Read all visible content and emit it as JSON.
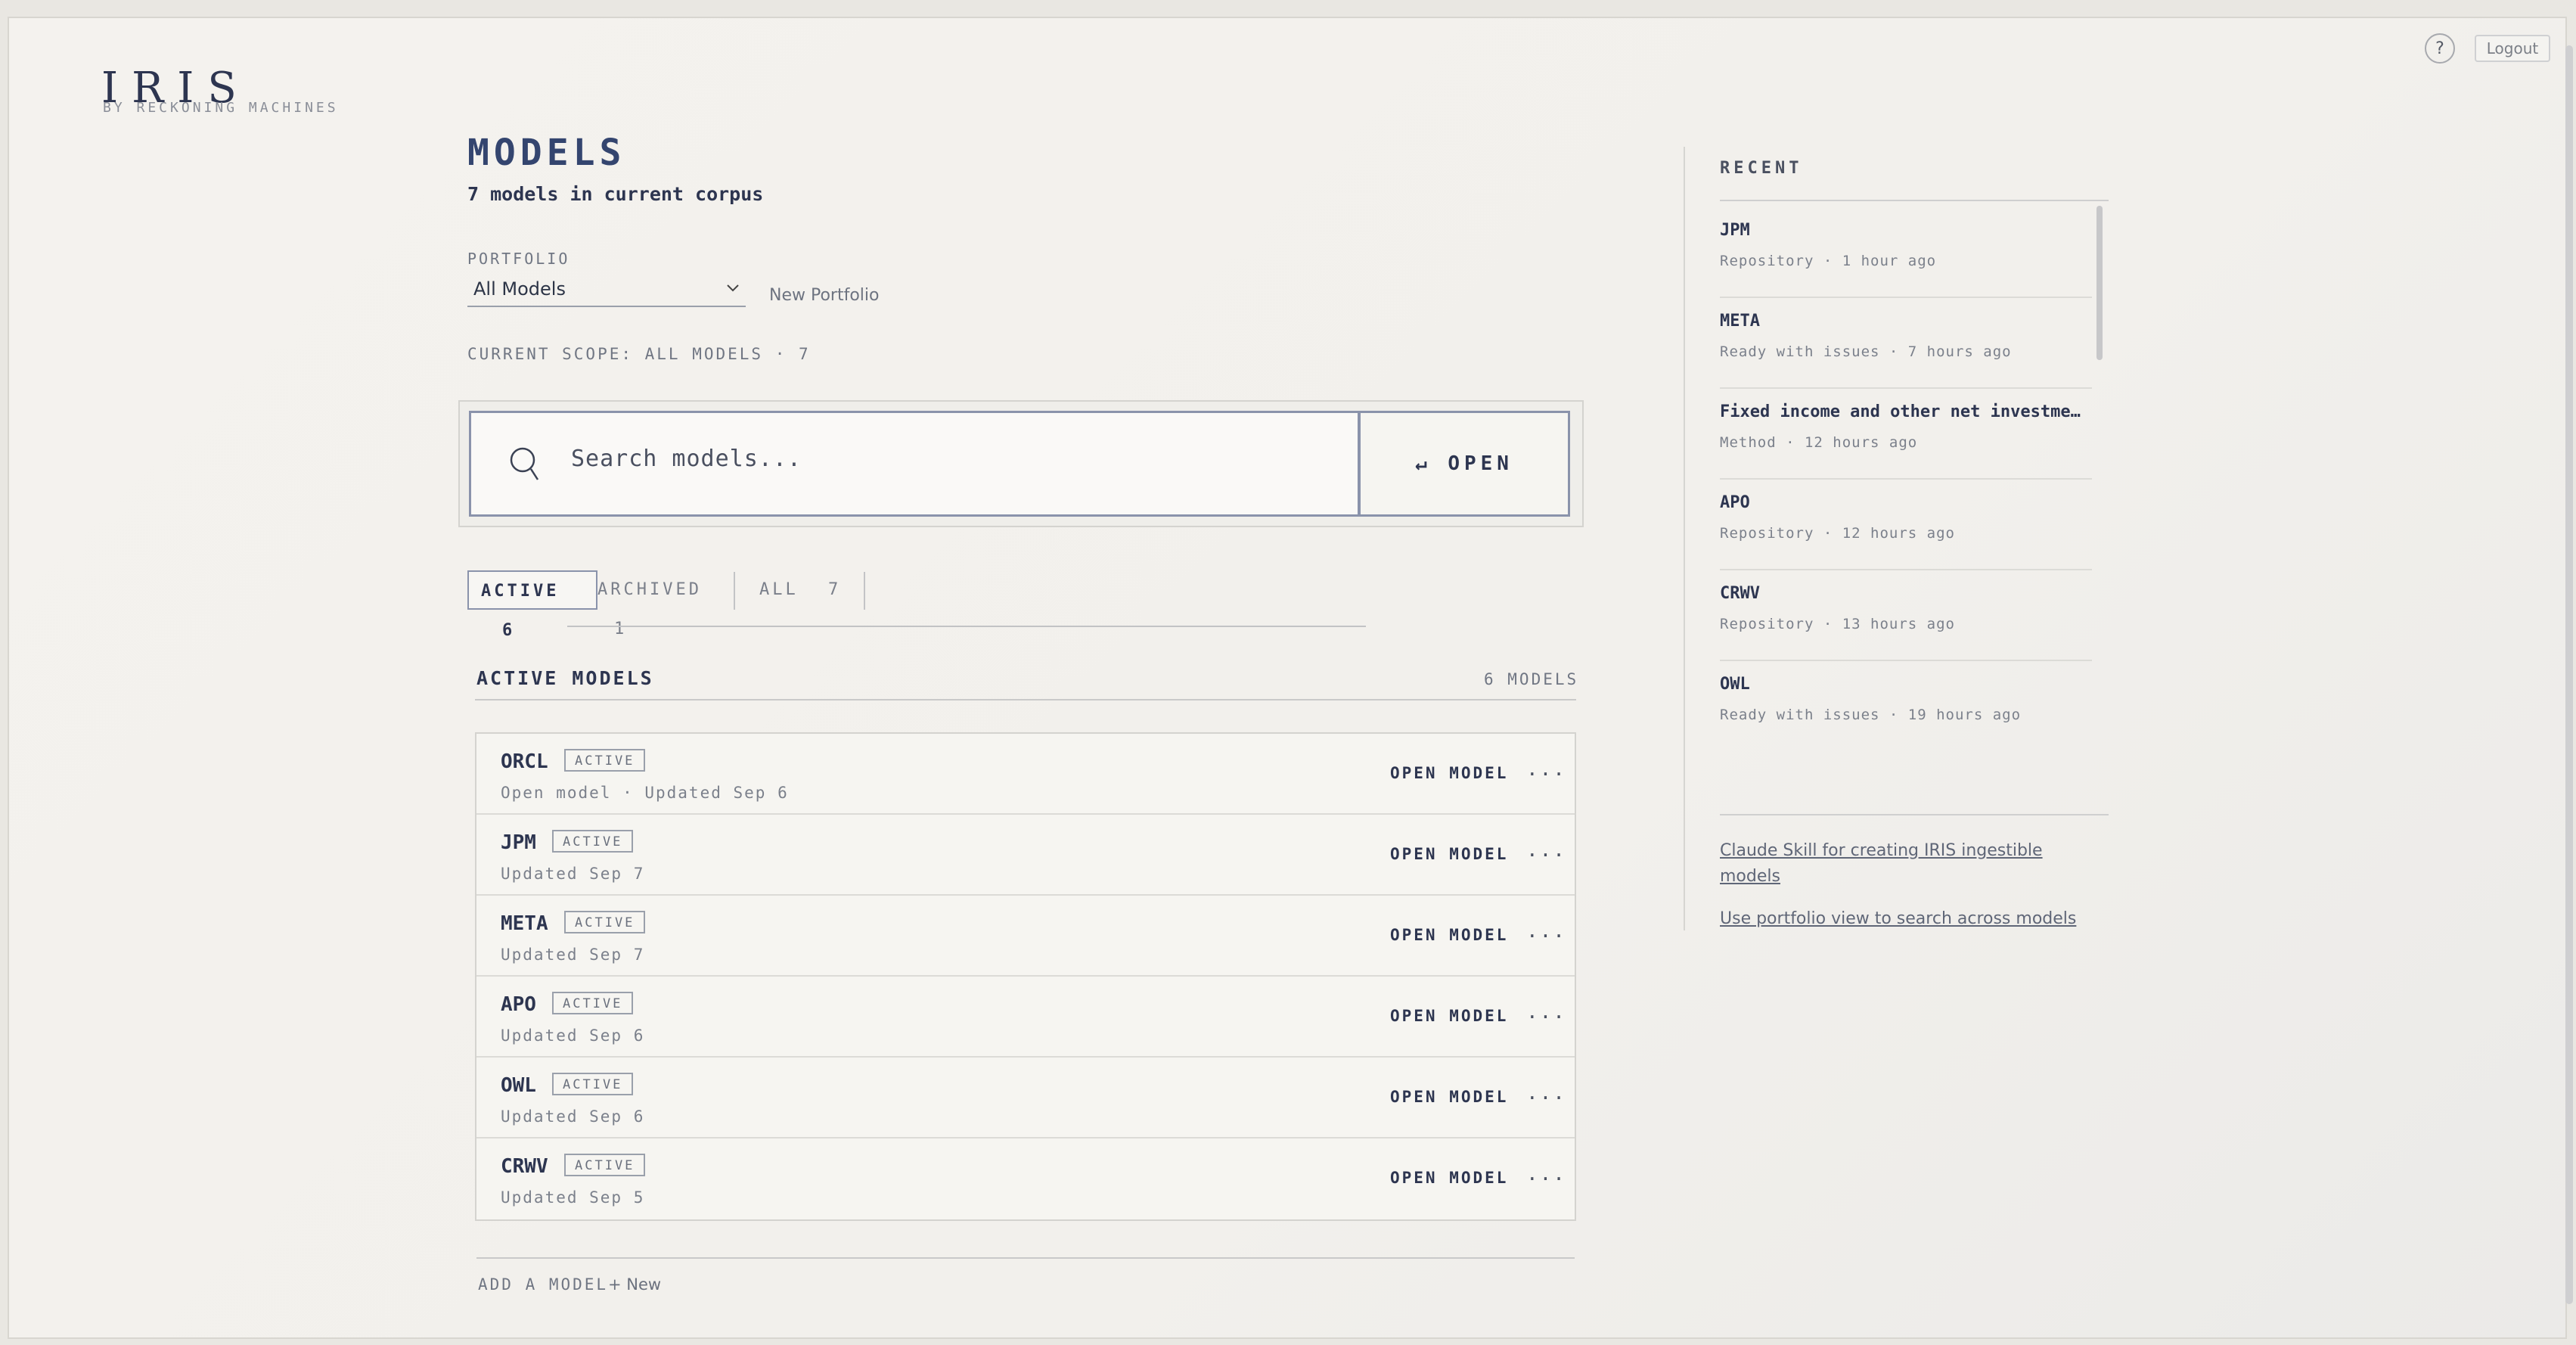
{
  "header": {
    "logo_title": "IRIS",
    "logo_subtitle": "BY RECKONING MACHINES",
    "help_label": "?",
    "logout_label": "Logout"
  },
  "main": {
    "title": "MODELS",
    "subtitle": "7 models in current corpus",
    "portfolio_label": "PORTFOLIO",
    "portfolio_selected": "All Models",
    "new_portfolio_label": "New Portfolio",
    "scope_text": "CURRENT SCOPE: ALL MODELS · 7"
  },
  "search": {
    "placeholder": "Search models...",
    "open_label": "↵ OPEN"
  },
  "tabs": [
    {
      "label": "ACTIVE",
      "count": "6"
    },
    {
      "label": "ARCHIVED",
      "count": "1"
    },
    {
      "label": "ALL",
      "count": "7"
    }
  ],
  "section": {
    "title": "ACTIVE MODELS",
    "count": "6 MODELS"
  },
  "models": [
    {
      "name": "ORCL",
      "badge": "ACTIVE",
      "meta": "Open model · Updated Sep 6",
      "open": "OPEN MODEL",
      "more": "..."
    },
    {
      "name": "JPM",
      "badge": "ACTIVE",
      "meta": "Updated Sep 7",
      "open": "OPEN MODEL",
      "more": "..."
    },
    {
      "name": "META",
      "badge": "ACTIVE",
      "meta": "Updated Sep 7",
      "open": "OPEN MODEL",
      "more": "..."
    },
    {
      "name": "APO",
      "badge": "ACTIVE",
      "meta": "Updated Sep 6",
      "open": "OPEN MODEL",
      "more": "..."
    },
    {
      "name": "OWL",
      "badge": "ACTIVE",
      "meta": "Updated Sep 6",
      "open": "OPEN MODEL",
      "more": "..."
    },
    {
      "name": "CRWV",
      "badge": "ACTIVE",
      "meta": "Updated Sep 5",
      "open": "OPEN MODEL",
      "more": "..."
    }
  ],
  "add_model": {
    "label": "ADD A MODEL",
    "new_label": "+ New"
  },
  "recent": {
    "title": "RECENT",
    "items": [
      {
        "name": "JPM",
        "meta": "Repository · 1 hour ago"
      },
      {
        "name": "META",
        "meta": "Ready with issues · 7 hours ago"
      },
      {
        "name": "Fixed income and other net investme…",
        "meta": "Method · 12 hours ago"
      },
      {
        "name": "APO",
        "meta": "Repository · 12 hours ago"
      },
      {
        "name": "CRWV",
        "meta": "Repository · 13 hours ago"
      },
      {
        "name": "OWL",
        "meta": "Ready with issues · 19 hours ago"
      }
    ],
    "link_skill": "Claude Skill for creating IRIS ingestible models",
    "link_portfolio": "Use portfolio view to search across models"
  }
}
